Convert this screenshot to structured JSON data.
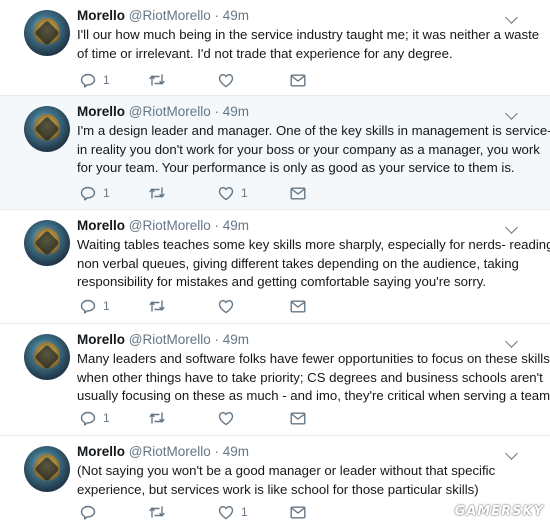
{
  "tweets": [
    {
      "name": "Morello",
      "handle": "@RiotMorello",
      "time": "49m",
      "lines": [
        "I'll our how much being in the service industry taught me; it was neither a waste",
        "of time or irrelevant. I'd not trade that experience for any degree."
      ],
      "reply_count": "1",
      "retweet_count": "",
      "like_count": ""
    },
    {
      "name": "Morello",
      "handle": "@RiotMorello",
      "time": "49m",
      "lines": [
        "I'm a design leader and manager. One of the key skills in management is service-",
        "in reality you don't work for your boss or your company as a manager, you work",
        "for your team. Your performance is only as good as your service to them is."
      ],
      "reply_count": "1",
      "retweet_count": "",
      "like_count": "1"
    },
    {
      "name": "Morello",
      "handle": "@RiotMorello",
      "time": "49m",
      "lines": [
        "Waiting tables teaches some key skills more sharply, especially for nerds- reading",
        "non verbal queues, giving different takes depending on the audience, taking",
        "responsibility for mistakes and getting comfortable saying you're sorry."
      ],
      "reply_count": "1",
      "retweet_count": "",
      "like_count": ""
    },
    {
      "name": "Morello",
      "handle": "@RiotMorello",
      "time": "49m",
      "lines": [
        "Many leaders and software folks have fewer opportunities to focus on these skills",
        "when other things have to take priority; CS degrees and business schools aren't",
        "usually focusing on these as much - and imo, they're critical when serving a team"
      ],
      "reply_count": "1",
      "retweet_count": "",
      "like_count": ""
    },
    {
      "name": "Morello",
      "handle": "@RiotMorello",
      "time": "49m",
      "lines": [
        "(Not saying you won't be a good manager or leader without that specific",
        "experience, but services work is like school for those particular skills)"
      ],
      "reply_count": "",
      "retweet_count": "",
      "like_count": "1"
    }
  ],
  "icons": {
    "reply": "reply-icon",
    "retweet": "retweet-icon",
    "like": "heart-icon",
    "message": "envelope-icon",
    "caret": "chevron-down-icon"
  },
  "colors": {
    "muted": "#657786",
    "highlight_bg": "#f5f8fa",
    "divider": "#e6ecf0"
  },
  "watermark": "GAMERSKY"
}
